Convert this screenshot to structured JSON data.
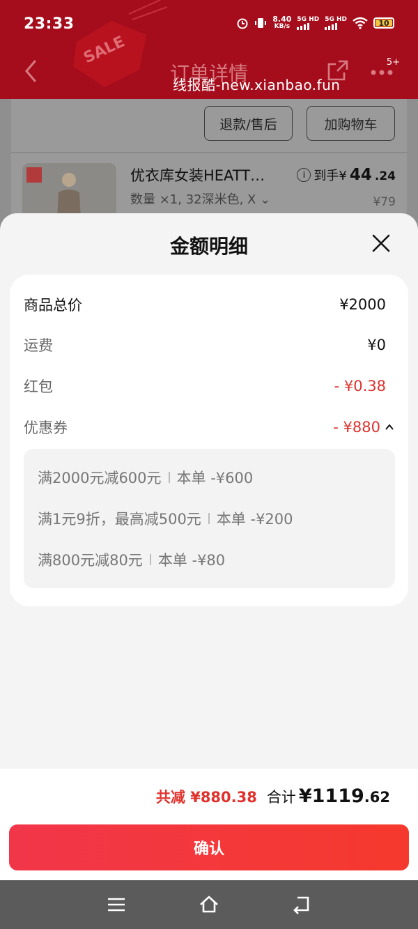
{
  "status_bar": {
    "time": "23:33",
    "speed": "8.40",
    "speed_unit": "KB/s",
    "net1": "5G HD",
    "net2": "5G HD",
    "battery": "10"
  },
  "header": {
    "title": "订单详情",
    "watermark": "线报酷-new.xianbao.fun",
    "badge": "5+"
  },
  "order": {
    "refund_button": "退款/售后",
    "cart_button": "加购物车",
    "product_name": "优衣库女装HEATT…",
    "spec": "数量 ×1, 32深米色, X ⌄",
    "price_label": "到手¥",
    "price_int": "44",
    "price_dec": ".24",
    "original_price": "¥79"
  },
  "sheet": {
    "title": "金额明细",
    "rows": [
      {
        "label": "商品总价",
        "value": "¥2000"
      },
      {
        "label": "运费",
        "value": "¥0"
      },
      {
        "label": "红包",
        "value": "- ¥0.38"
      },
      {
        "label": "优惠券",
        "value": "- ¥880"
      }
    ],
    "coupons": [
      {
        "name": "满2000元减600元",
        "detail": "本单 -¥600"
      },
      {
        "name": "满1元9折，最高减500元",
        "detail": "本单 -¥200"
      },
      {
        "name": "满800元减80元",
        "detail": "本单 -¥80"
      }
    ]
  },
  "footer": {
    "saved": "共减 ¥880.38",
    "total_label": "合计",
    "total_int": "¥1119",
    "total_dec": ".62",
    "confirm": "确认"
  },
  "colors": {
    "header": "#a50d1c",
    "discount": "#e0322d",
    "confirm_button": "#f2364a"
  },
  "icons": [
    "back-arrow-icon",
    "share-icon",
    "more-icon",
    "info-icon",
    "close-icon",
    "chevron-up-icon",
    "menu-icon",
    "home-icon",
    "return-icon"
  ]
}
